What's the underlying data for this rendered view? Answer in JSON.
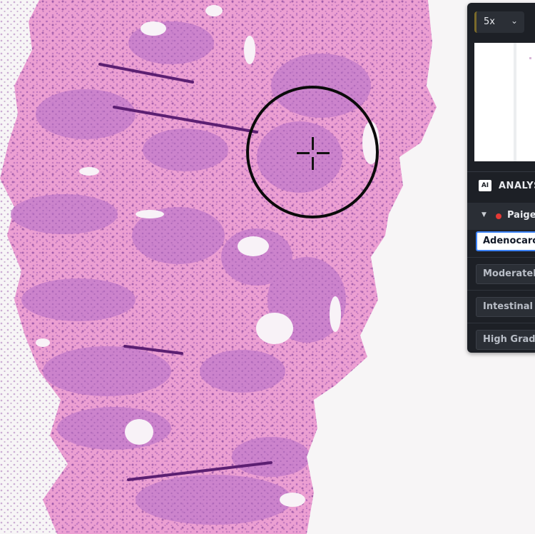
{
  "viewer": {
    "zoom": "5x",
    "image_kind": "H&E stained tissue section"
  },
  "panel": {
    "zoom_label": "5x",
    "analysis_title": "ANALYSIS",
    "ai_badge": "AI",
    "model_name": "Paige",
    "model_status_color": "#e53935",
    "results": [
      {
        "label": "Adenocarcinoma",
        "selected": true
      },
      {
        "label": "Moderately Differentiated",
        "selected": false
      },
      {
        "label": "Intestinal Type",
        "selected": false
      },
      {
        "label": "High Grade Dysplasia",
        "selected": false
      }
    ]
  },
  "colors": {
    "panel_bg": "#1d2026",
    "accent": "#3b82f6",
    "stain_pink": "#e9a7d6",
    "stain_purple": "#9a4fb0"
  }
}
